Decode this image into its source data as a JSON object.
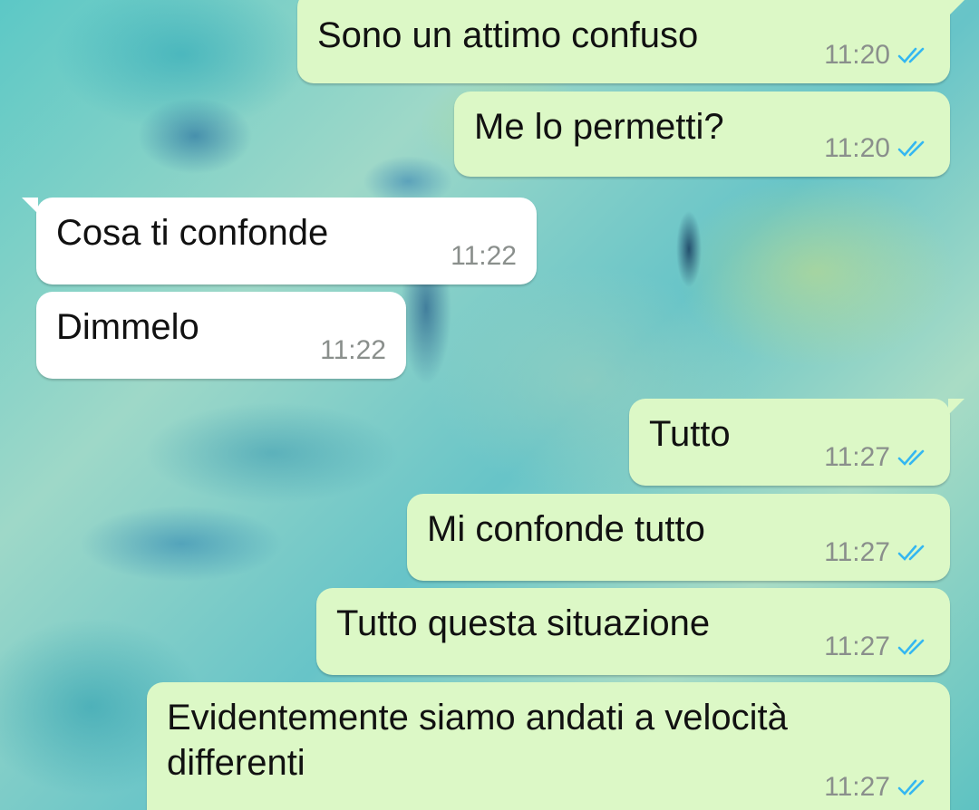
{
  "colors": {
    "outgoing_bubble": "#dcf8c6",
    "incoming_bubble": "#ffffff",
    "read_ticks": "#34b7f1",
    "timestamp": "#8a8f8c"
  },
  "messages": [
    {
      "direction": "out",
      "text": "Sono un attimo confuso",
      "time": "11:20",
      "status": "read-double-check-icon"
    },
    {
      "direction": "out",
      "text": "Me lo permetti?",
      "time": "11:20",
      "status": "read-double-check-icon"
    },
    {
      "direction": "in",
      "text": "Cosa ti confonde",
      "time": "11:22"
    },
    {
      "direction": "in",
      "text": "Dimmelo",
      "time": "11:22"
    },
    {
      "direction": "out",
      "text": "Tutto",
      "time": "11:27",
      "status": "read-double-check-icon"
    },
    {
      "direction": "out",
      "text": "Mi confonde tutto",
      "time": "11:27",
      "status": "read-double-check-icon"
    },
    {
      "direction": "out",
      "text": "Tutto questa situazione",
      "time": "11:27",
      "status": "read-double-check-icon"
    },
    {
      "direction": "out",
      "text": "Evidentemente siamo andati a velocità\ndifferenti",
      "time": "11:27",
      "status": "read-double-check-icon"
    }
  ]
}
